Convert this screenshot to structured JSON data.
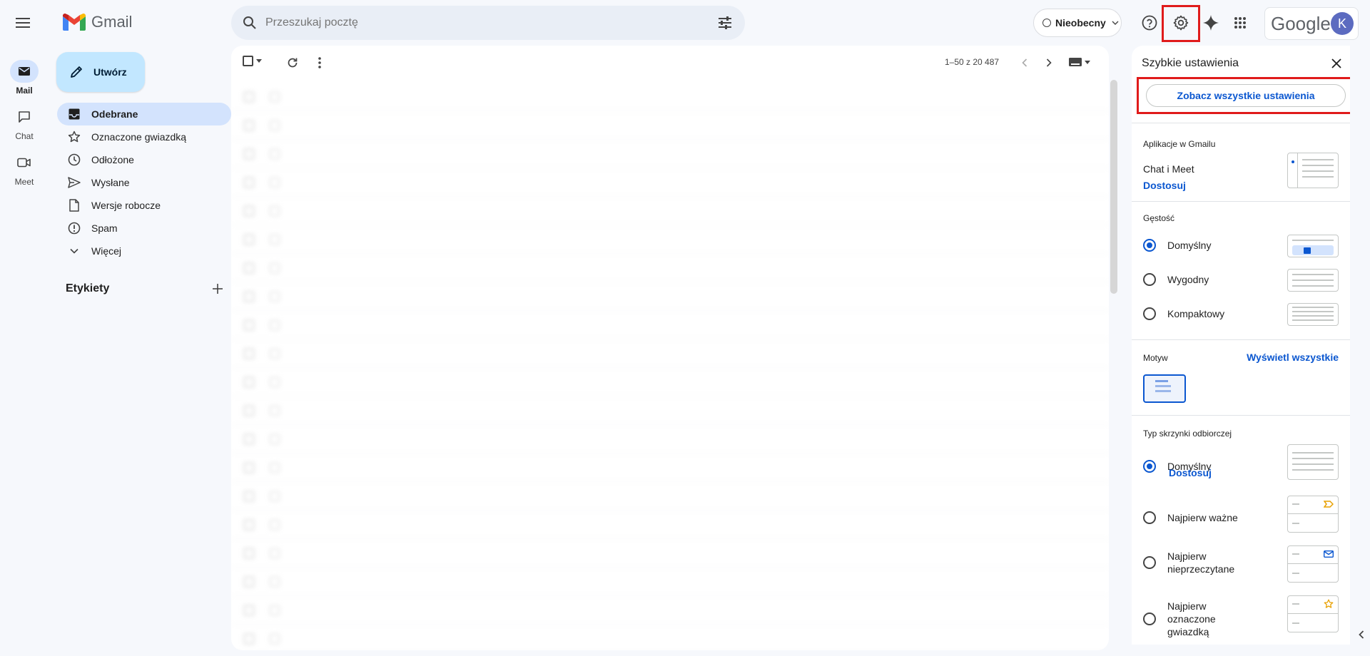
{
  "app": {
    "name": "Gmail"
  },
  "search": {
    "placeholder": "Przeszukaj pocztę"
  },
  "status": {
    "label": "Nieobecny"
  },
  "account": {
    "brand": "Google",
    "avatar_letter": "K"
  },
  "rail": {
    "items": [
      {
        "label": "Mail"
      },
      {
        "label": "Chat"
      },
      {
        "label": "Meet"
      }
    ]
  },
  "compose": {
    "label": "Utwórz"
  },
  "nav": {
    "items": [
      {
        "label": "Odebrane",
        "icon": "inbox-icon"
      },
      {
        "label": "Oznaczone gwiazdką",
        "icon": "star-icon"
      },
      {
        "label": "Odłożone",
        "icon": "clock-icon"
      },
      {
        "label": "Wysłane",
        "icon": "send-icon"
      },
      {
        "label": "Wersje robocze",
        "icon": "draft-icon"
      },
      {
        "label": "Spam",
        "icon": "spam-icon"
      },
      {
        "label": "Więcej",
        "icon": "chevron-down-icon"
      }
    ]
  },
  "labels": {
    "title": "Etykiety"
  },
  "toolbar": {
    "pager": "1–50 z 20 487"
  },
  "mails": [
    {
      "sender": "",
      "subject": "",
      "snippet": "",
      "date": ""
    },
    {
      "sender": "",
      "subject": "",
      "snippet": "",
      "date": ""
    },
    {
      "sender": "",
      "subject": "",
      "snippet": "",
      "date": ""
    },
    {
      "sender": "",
      "subject": "",
      "snippet": "",
      "date": ""
    },
    {
      "sender": "",
      "subject": "",
      "snippet": "",
      "date": ""
    },
    {
      "sender": "",
      "subject": "",
      "snippet": "",
      "date": ""
    },
    {
      "sender": "",
      "subject": "",
      "snippet": "",
      "date": ""
    },
    {
      "sender": "",
      "subject": "",
      "snippet": "",
      "date": ""
    },
    {
      "sender": "",
      "subject": "",
      "snippet": "",
      "date": ""
    },
    {
      "sender": "",
      "subject": "",
      "snippet": "",
      "date": ""
    },
    {
      "sender": "",
      "subject": "",
      "snippet": "",
      "date": ""
    },
    {
      "sender": "",
      "subject": "",
      "snippet": "",
      "date": ""
    },
    {
      "sender": "",
      "subject": "",
      "snippet": "",
      "date": ""
    },
    {
      "sender": "",
      "subject": "",
      "snippet": "",
      "date": ""
    },
    {
      "sender": "",
      "subject": "",
      "snippet": "",
      "date": ""
    },
    {
      "sender": "",
      "subject": "",
      "snippet": "",
      "date": ""
    },
    {
      "sender": "",
      "subject": "",
      "snippet": "",
      "date": ""
    },
    {
      "sender": "",
      "subject": "",
      "snippet": "",
      "date": ""
    },
    {
      "sender": "",
      "subject": "",
      "snippet": "",
      "date": ""
    },
    {
      "sender": "",
      "subject": "",
      "snippet": "",
      "date": ""
    }
  ],
  "quick_settings": {
    "title": "Szybkie ustawienia",
    "all_settings": "Zobacz wszystkie ustawienia",
    "apps": {
      "title": "Aplikacje w Gmailu",
      "item": "Chat i Meet",
      "link": "Dostosuj"
    },
    "density": {
      "title": "Gęstość",
      "options": [
        "Domyślny",
        "Wygodny",
        "Kompaktowy"
      ],
      "selected": "Domyślny"
    },
    "theme": {
      "title": "Motyw",
      "link": "Wyświetl wszystkie"
    },
    "inbox": {
      "title": "Typ skrzynki odbiorczej",
      "options": [
        "Domyślny",
        "Najpierw ważne",
        "Najpierw nieprzeczytane",
        "Najpierw oznaczone gwiazdką"
      ],
      "link": "Dostosuj",
      "selected": "Domyślny"
    }
  },
  "colors": {
    "accent": "#0b57d0",
    "highlight": "#e01b1b",
    "selected_nav": "#d3e3fd",
    "compose": "#c2e7ff"
  }
}
